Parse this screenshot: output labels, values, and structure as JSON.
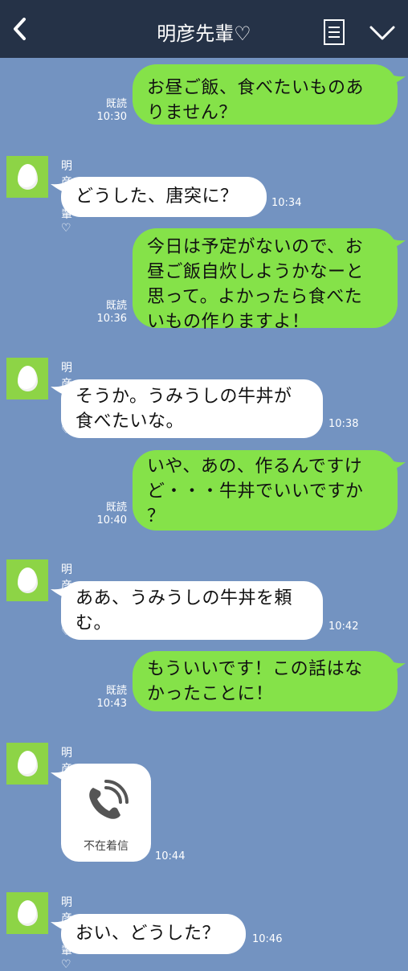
{
  "header": {
    "title": "明彦先輩♡"
  },
  "messages": [
    {
      "side": "out",
      "lines": [
        "お昼ご飯、食べたいものあ",
        "りません？"
      ],
      "read": "既読",
      "time": "10:30"
    },
    {
      "side": "in",
      "sender": "明彦先輩♡",
      "lines": [
        "どうした、唐突に？"
      ],
      "time": "10:34"
    },
    {
      "side": "out",
      "lines": [
        "今日は予定がないので、お",
        "昼ご飯自炊しようかなーと",
        "思って。よかったら食べた",
        "いもの作りますよ！"
      ],
      "read": "既読",
      "time": "10:36"
    },
    {
      "side": "in",
      "sender": "明彦先輩♡",
      "lines": [
        "そうか。うみうしの牛丼が",
        "食べたいな。"
      ],
      "time": "10:38"
    },
    {
      "side": "out",
      "lines": [
        "いや、あの、作るんですけ",
        "ど・・・牛丼でいいですか",
        "？"
      ],
      "read": "既読",
      "time": "10:40"
    },
    {
      "side": "in",
      "sender": "明彦先輩♡",
      "lines": [
        "ああ、うみうしの牛丼を頼",
        "む。"
      ],
      "time": "10:42"
    },
    {
      "side": "out",
      "lines": [
        "もういいです！この話はな",
        "かったことに！"
      ],
      "read": "既読",
      "time": "10:43"
    },
    {
      "side": "call",
      "sender": "明彦先輩♡",
      "label": "不在着信",
      "icon": "phone-missed-icon",
      "time": "10:44"
    },
    {
      "side": "in",
      "sender": "明彦先輩♡",
      "lines": [
        "おい、どうした？"
      ],
      "time": "10:46"
    }
  ],
  "colors": {
    "background": "#7393c1",
    "header": "#253247",
    "outgoing": "#85e249",
    "incoming": "#ffffff",
    "avatar": "#8dd446"
  }
}
